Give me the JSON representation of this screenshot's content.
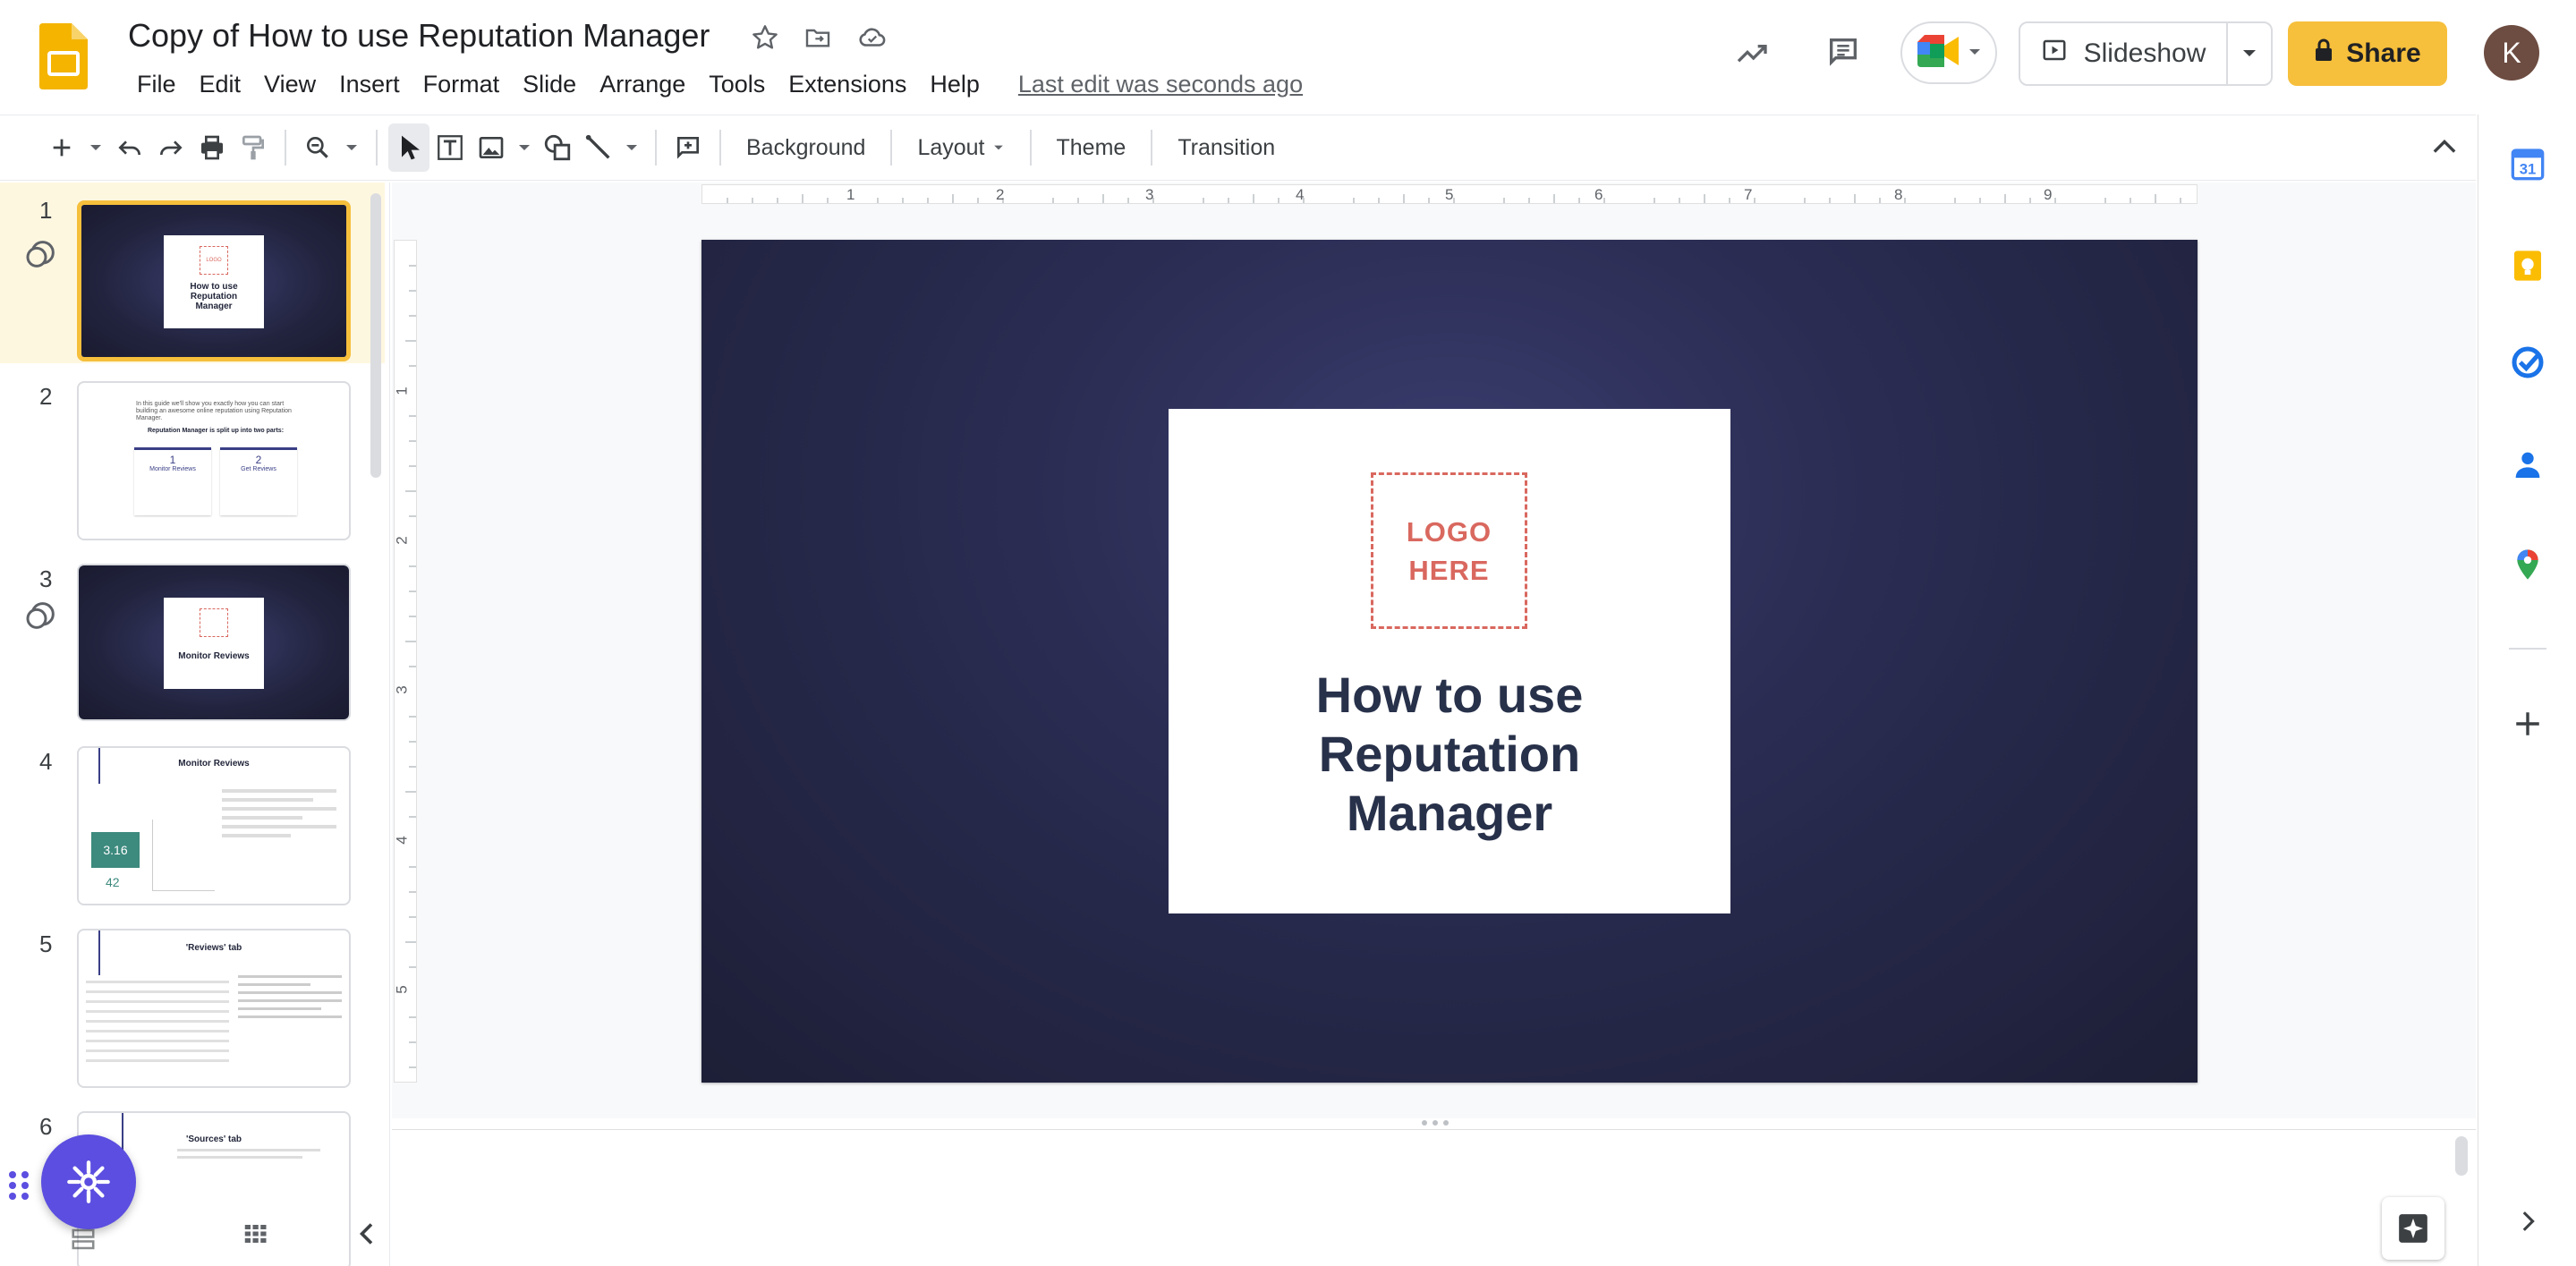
{
  "header": {
    "doc_title": "Copy of How to use Reputation Manager",
    "last_edit": "Last edit was seconds ago",
    "slideshow_label": "Slideshow",
    "share_label": "Share",
    "avatar_initial": "K"
  },
  "menu": [
    "File",
    "Edit",
    "View",
    "Insert",
    "Format",
    "Slide",
    "Arrange",
    "Tools",
    "Extensions",
    "Help"
  ],
  "toolbar": {
    "background_label": "Background",
    "layout_label": "Layout",
    "theme_label": "Theme",
    "transition_label": "Transition"
  },
  "ruler": {
    "h_labels": [
      "1",
      "2",
      "3",
      "4",
      "5",
      "6",
      "7",
      "8",
      "9"
    ],
    "v_labels": [
      "1",
      "2",
      "3",
      "4",
      "5"
    ]
  },
  "slide": {
    "logo_line1": "LOGO",
    "logo_line2": "HERE",
    "title_line1": "How to use",
    "title_line2": "Reputation",
    "title_line3": "Manager"
  },
  "filmstrip": {
    "slides": [
      {
        "num": "1",
        "title": "How to use Reputation Manager"
      },
      {
        "num": "2",
        "intro": "In this guide we'll show you exactly how you can start building an awesome online reputation using Reputation Manager.",
        "subtitle": "Reputation Manager is split up into two parts:",
        "part1_num": "1",
        "part1_title": "Monitor Reviews",
        "part2_num": "2",
        "part2_title": "Get Reviews"
      },
      {
        "num": "3",
        "title": "Monitor Reviews"
      },
      {
        "num": "4",
        "title": "Monitor Reviews",
        "rating": "3.16",
        "count": "42"
      },
      {
        "num": "5",
        "title": "'Reviews' tab"
      },
      {
        "num": "6",
        "title": "'Sources' tab"
      }
    ]
  },
  "colors": {
    "accent_yellow": "#f6bf3c",
    "logo_red": "#d9685f",
    "slide_bg": "#2a2c52",
    "title_navy": "#28314a",
    "fab_purple": "#5b4ee0"
  }
}
